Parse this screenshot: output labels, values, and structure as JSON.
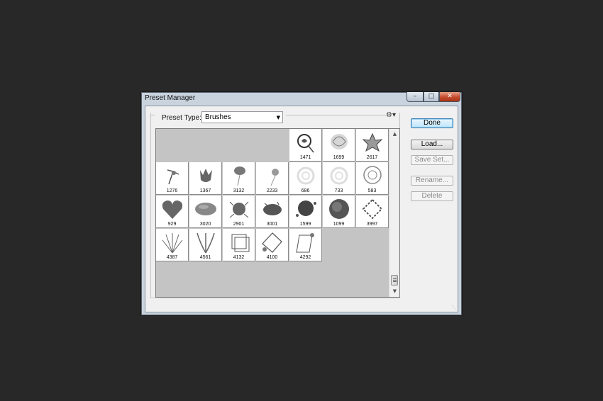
{
  "window": {
    "title": "Preset Manager"
  },
  "controls": {
    "minimize": "–",
    "maximize": "□",
    "close": "✕"
  },
  "preset_type": {
    "label": "Preset Type:",
    "value": "Brushes"
  },
  "buttons": {
    "done": "Done",
    "load": "Load...",
    "save_set": "Save Set...",
    "rename": "Rename...",
    "delete": "Delete"
  },
  "brushes": [
    {
      "size": "1471",
      "icon": "rose-curl-icon"
    },
    {
      "size": "1699",
      "icon": "scribble-rose-icon"
    },
    {
      "size": "2617",
      "icon": "lily-icon"
    },
    {
      "size": "1276",
      "icon": "sketch-flower-icon"
    },
    {
      "size": "1367",
      "icon": "tulip-icon"
    },
    {
      "size": "3132",
      "icon": "rosebud-icon"
    },
    {
      "size": "2233",
      "icon": "flower-stem-icon"
    },
    {
      "size": "686",
      "icon": "faint-swirl-icon"
    },
    {
      "size": "733",
      "icon": "faint-swirl-icon"
    },
    {
      "size": "583",
      "icon": "rose-outline-icon"
    },
    {
      "size": "929",
      "icon": "heart-icon"
    },
    {
      "size": "3020",
      "icon": "paint-blob-icon"
    },
    {
      "size": "2901",
      "icon": "splatter-flower-icon"
    },
    {
      "size": "3001",
      "icon": "splatter-blob-icon"
    },
    {
      "size": "1599",
      "icon": "splatter-round-icon"
    },
    {
      "size": "1099",
      "icon": "watercolor-circle-icon"
    },
    {
      "size": "3997",
      "icon": "floral-wreath-icon"
    },
    {
      "size": "4387",
      "icon": "herb-bunch-icon"
    },
    {
      "size": "4561",
      "icon": "grass-bunch-icon"
    },
    {
      "size": "4132",
      "icon": "square-frame-icon"
    },
    {
      "size": "4100",
      "icon": "floral-frame-icon"
    },
    {
      "size": "4292",
      "icon": "diamond-frame-icon"
    }
  ]
}
